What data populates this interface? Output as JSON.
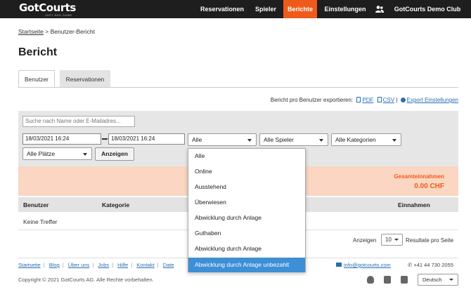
{
  "header": {
    "logo": "GotCourts",
    "logo_tagline": "JUST ADD GAME",
    "nav": [
      "Reservationen",
      "Spieler",
      "Berichte",
      "Einstellungen"
    ],
    "active_nav": "Berichte",
    "club_name": "GotCourts Demo Club",
    "accent_color": "#ef5a1b"
  },
  "breadcrumb": {
    "home": "Startseite",
    "separator": ">",
    "current": "Benutzer-Bericht"
  },
  "page_title": "Bericht",
  "tabs": [
    "Benutzer",
    "Reservationen"
  ],
  "export": {
    "label": "Bericht pro Benutzer exportieren:",
    "pdf": "PDF",
    "csv": "CSV",
    "divider": "|",
    "settings": "Export Einstellungen"
  },
  "filters": {
    "search_placeholder": "Suche nach Name oder E-Mailadresse",
    "search_display": "Suche nach Name oder E-Mailadres...",
    "date_from": "18/03/2021 16:24",
    "date_to": "18/03/2021 16:24",
    "status_select": "Alle",
    "player_select": "Alle Spieler",
    "category_select": "Alle Kategorien",
    "court_select": "Alle Plätze",
    "show_button": "Anzeigen"
  },
  "summary": {
    "label": "Gesamteinnahmen",
    "value": "0.00 CHF"
  },
  "table": {
    "columns": [
      "Benutzer",
      "Kategorie",
      "Einnahmen"
    ],
    "empty_text": "Keine Treffer"
  },
  "pager": {
    "label": "Anzeigen",
    "value": "10",
    "suffix": "Resultate pro Seite"
  },
  "dropdown": {
    "options": [
      "Alle",
      "Online",
      "Ausstehend",
      "Überwiesen",
      "Abwicklung durch Anlage",
      "Guthaben",
      "Abwicklung durch Anlage",
      "Abwicklung durch Anlage unbezahlt"
    ],
    "highlighted_index": 7,
    "highlight_color": "#3d8fd6"
  },
  "footer": {
    "links": [
      "Startseite",
      "Blog",
      "Über uns",
      "Jobs",
      "Hilfe",
      "Kontakt",
      "Date"
    ],
    "email": "info@gotcourts.com",
    "phone": "+41 44 730 2055",
    "copyright": "Copyright © 2021 GotCourts AG. Alle Rechte vorbehalten.",
    "language": "Deutsch"
  }
}
